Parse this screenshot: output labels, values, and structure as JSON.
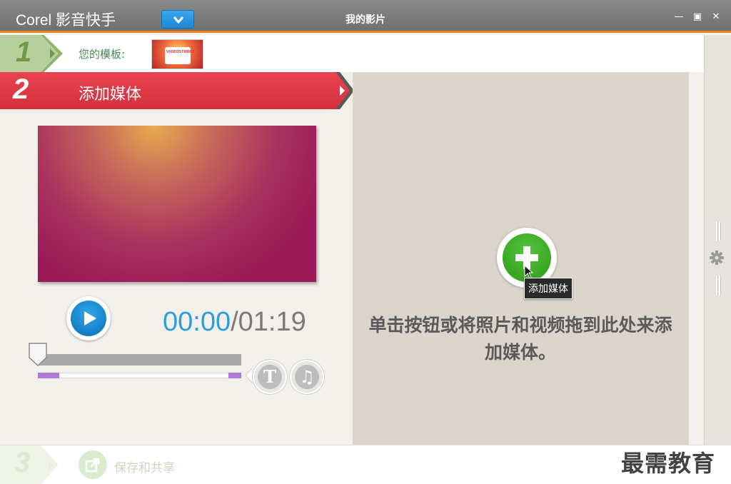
{
  "titlebar": {
    "app_title": "Corel 影音快手",
    "window_title": "我的影片",
    "minimize": "—",
    "maximize": "▣",
    "close": "✕"
  },
  "step1": {
    "number": "1",
    "label": "您的模板:",
    "thumb_text": "VIDEOSTUDIO"
  },
  "step2": {
    "number": "2",
    "label": "添加媒体"
  },
  "player": {
    "current_time": "00:00",
    "separator": "/",
    "total_time": "01:19",
    "title_button": "T",
    "music_button": "♫",
    "scrub_position": 0
  },
  "media_area": {
    "tooltip": "添加媒体",
    "hint": "单击按钮或将照片和视频拖到此处来添加媒体。"
  },
  "step3": {
    "number": "3",
    "label": "保存和共享"
  },
  "watermark": "最需教育",
  "colors": {
    "accent_orange": "#f08024",
    "step2_red": "#e8434f",
    "play_blue": "#1d88d6",
    "add_green": "#3aa824",
    "trim_purple": "#b17ad8"
  },
  "icons": [
    "chevron-down-icon",
    "play-icon",
    "plus-icon",
    "gear-icon",
    "share-icon",
    "music-icon",
    "title-icon"
  ]
}
